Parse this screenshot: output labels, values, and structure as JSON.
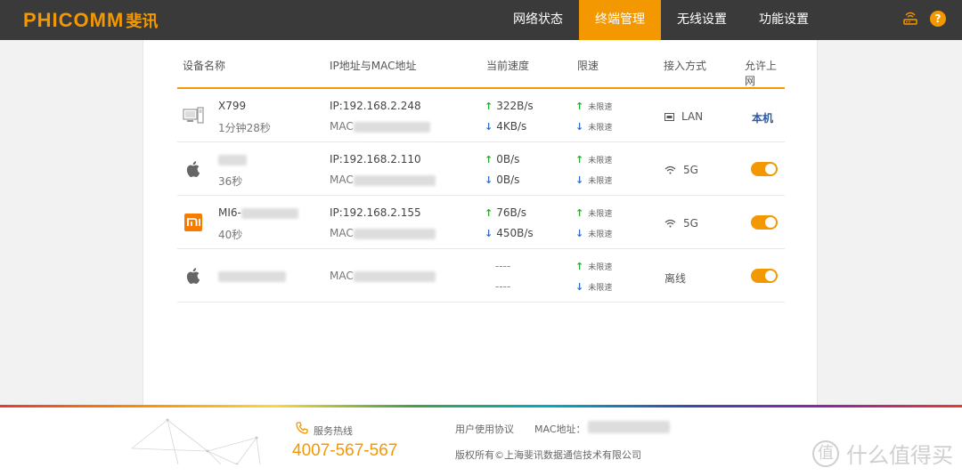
{
  "header": {
    "logo_latin": "PHICOMM",
    "logo_cn": "斐讯",
    "nav": [
      "网络状态",
      "终端管理",
      "无线设置",
      "功能设置"
    ],
    "active_nav": "终端管理",
    "help": "?"
  },
  "table": {
    "columns": [
      "设备名称",
      "IP地址与MAC地址",
      "当前速度",
      "限速",
      "接入方式",
      "允许上网"
    ],
    "rows": [
      {
        "icon": "desktop-icon",
        "name": "X799",
        "duration": "1分钟28秒",
        "ip": "IP:192.168.2.248",
        "mac": "MAC",
        "up": "322B/s",
        "down": "4KB/s",
        "limit_up": "未限速",
        "limit_down": "未限速",
        "access": "LAN",
        "allow": "本机"
      },
      {
        "icon": "apple-icon",
        "name": "",
        "duration": "36秒",
        "ip": "IP:192.168.2.110",
        "mac": "MAC",
        "up": "0B/s",
        "down": "0B/s",
        "limit_up": "未限速",
        "limit_down": "未限速",
        "access": "5G",
        "allow": "on"
      },
      {
        "icon": "xiaomi-icon",
        "name": "MI6-",
        "duration": "40秒",
        "ip": "IP:192.168.2.155",
        "mac": "MAC",
        "up": "76B/s",
        "down": "450B/s",
        "limit_up": "未限速",
        "limit_down": "未限速",
        "access": "5G",
        "allow": "on"
      },
      {
        "icon": "apple-icon",
        "name": "",
        "duration": "",
        "ip": "",
        "mac": "MAC",
        "up": "----",
        "down": "----",
        "limit_up": "未限速",
        "limit_down": "未限速",
        "access": "离线",
        "allow": "on"
      }
    ]
  },
  "footer": {
    "hotline_label": "服务热线",
    "hotline_number": "4007-567-567",
    "agreement": "用户使用协议",
    "mac_label": "MAC地址：",
    "copyright": "版权所有©上海斐讯数据通信技术有限公司",
    "watermark_text": "什么值得买",
    "watermark_icon": "值"
  },
  "colors": {
    "accent": "#f39800",
    "header_bg": "#3a3a3a",
    "up_arrow": "#2aa830",
    "down_arrow": "#2a6fd0"
  }
}
